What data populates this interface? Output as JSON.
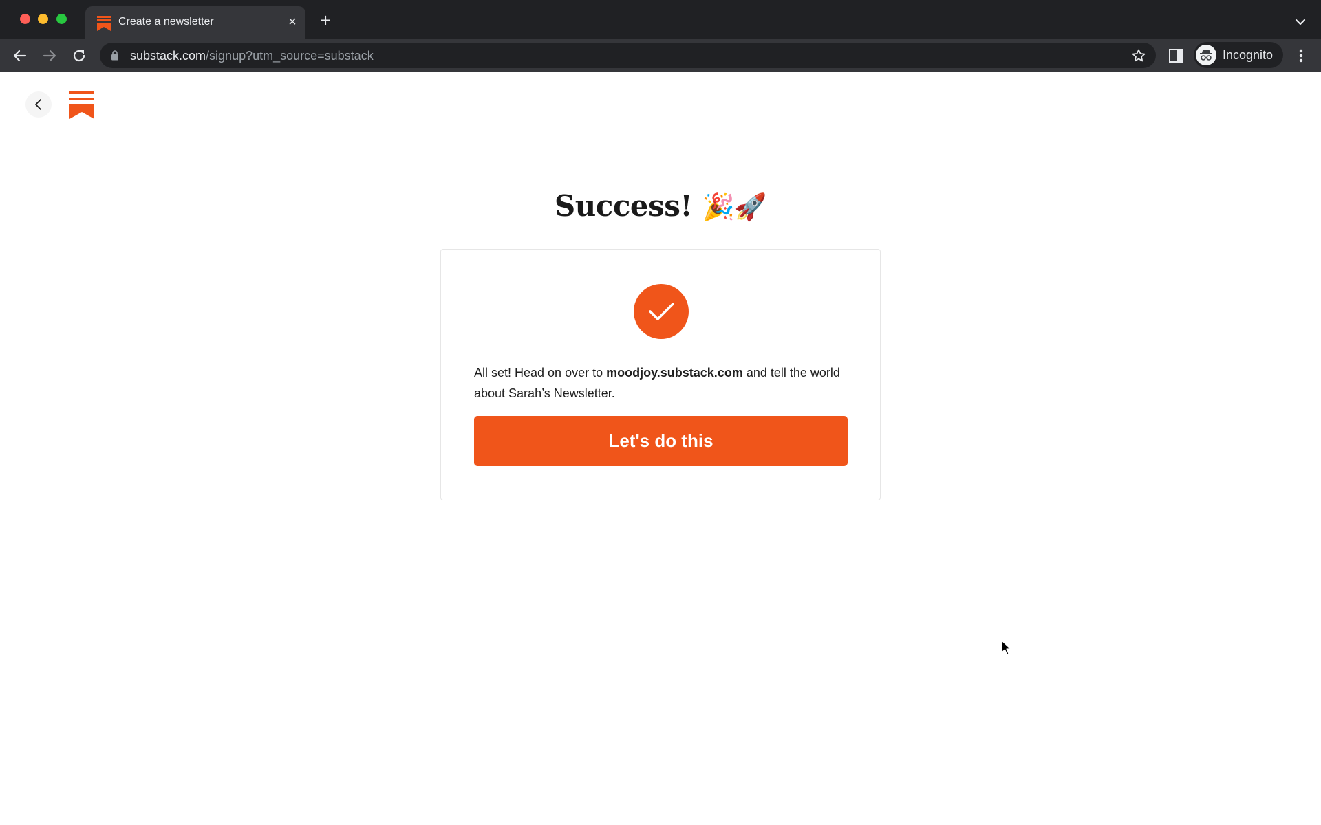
{
  "browser": {
    "tab": {
      "title": "Create a newsletter",
      "close_label": "×"
    },
    "new_tab_label": "+",
    "address_bar": {
      "host": "substack.com",
      "path": "/signup?utm_source=substack"
    },
    "profile": {
      "label": "Incognito"
    },
    "colors": {
      "traffic_red": "#ff5f57",
      "traffic_yellow": "#febc2e",
      "traffic_green": "#28c840"
    }
  },
  "page": {
    "brand_color": "#f0551a",
    "headline": "Success!",
    "headline_emoji": "🎉🚀",
    "card": {
      "message_before": "All set! Head on over to ",
      "message_link": "moodjoy.substack.com",
      "message_after": " and tell the world about Sarah’s Newsletter.",
      "cta_label": "Let's do this"
    }
  }
}
